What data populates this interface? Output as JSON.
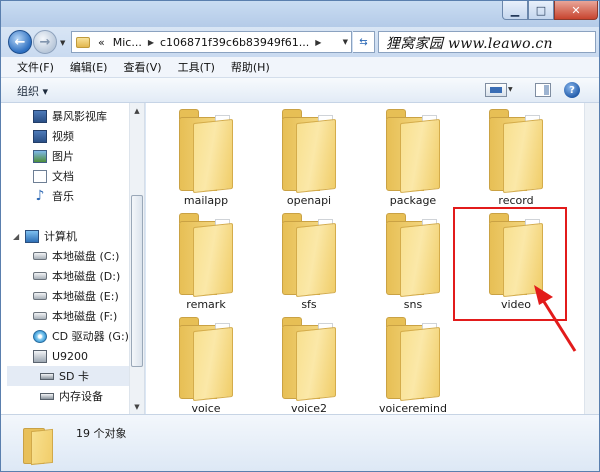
{
  "address": {
    "segments": [
      "«",
      "Mic...",
      "c106871f39c6b83949f61..."
    ],
    "refresh_icon": "refresh-arrows-icon"
  },
  "watermark": "狸窝家园 www.leawo.cn",
  "menu": [
    "文件(F)",
    "编辑(E)",
    "查看(V)",
    "工具(T)",
    "帮助(H)"
  ],
  "toolbar": {
    "organize_label": "组织 ▾"
  },
  "nav": {
    "libraries": [
      {
        "label": "暴风影视库",
        "icon": "video-library-icon"
      },
      {
        "label": "视频",
        "icon": "video-icon"
      },
      {
        "label": "图片",
        "icon": "pictures-icon"
      },
      {
        "label": "文档",
        "icon": "documents-icon"
      },
      {
        "label": "音乐",
        "icon": "music-icon"
      }
    ],
    "computer_label": "计算机",
    "drives": [
      {
        "label": "本地磁盘 (C:)",
        "icon": "system-drive-icon"
      },
      {
        "label": "本地磁盘 (D:)",
        "icon": "drive-icon"
      },
      {
        "label": "本地磁盘 (E:)",
        "icon": "drive-icon"
      },
      {
        "label": "本地磁盘 (F:)",
        "icon": "drive-icon"
      },
      {
        "label": "CD 驱动器 (G:) H",
        "icon": "cd-drive-icon"
      },
      {
        "label": "U9200",
        "icon": "phone-device-icon"
      },
      {
        "label": "SD 卡",
        "icon": "sd-card-icon",
        "selected": true
      },
      {
        "label": "内存设备",
        "icon": "storage-device-icon"
      }
    ]
  },
  "folders": [
    "mailapp",
    "openapi",
    "package",
    "record",
    "remark",
    "sfs",
    "sns",
    "video",
    "voice",
    "voice2",
    "voiceremind"
  ],
  "highlighted_folder": "video",
  "status": {
    "count_text": "19 个对象"
  },
  "colors": {
    "highlight": "#e21b1b",
    "folder": "#f3d67f"
  }
}
